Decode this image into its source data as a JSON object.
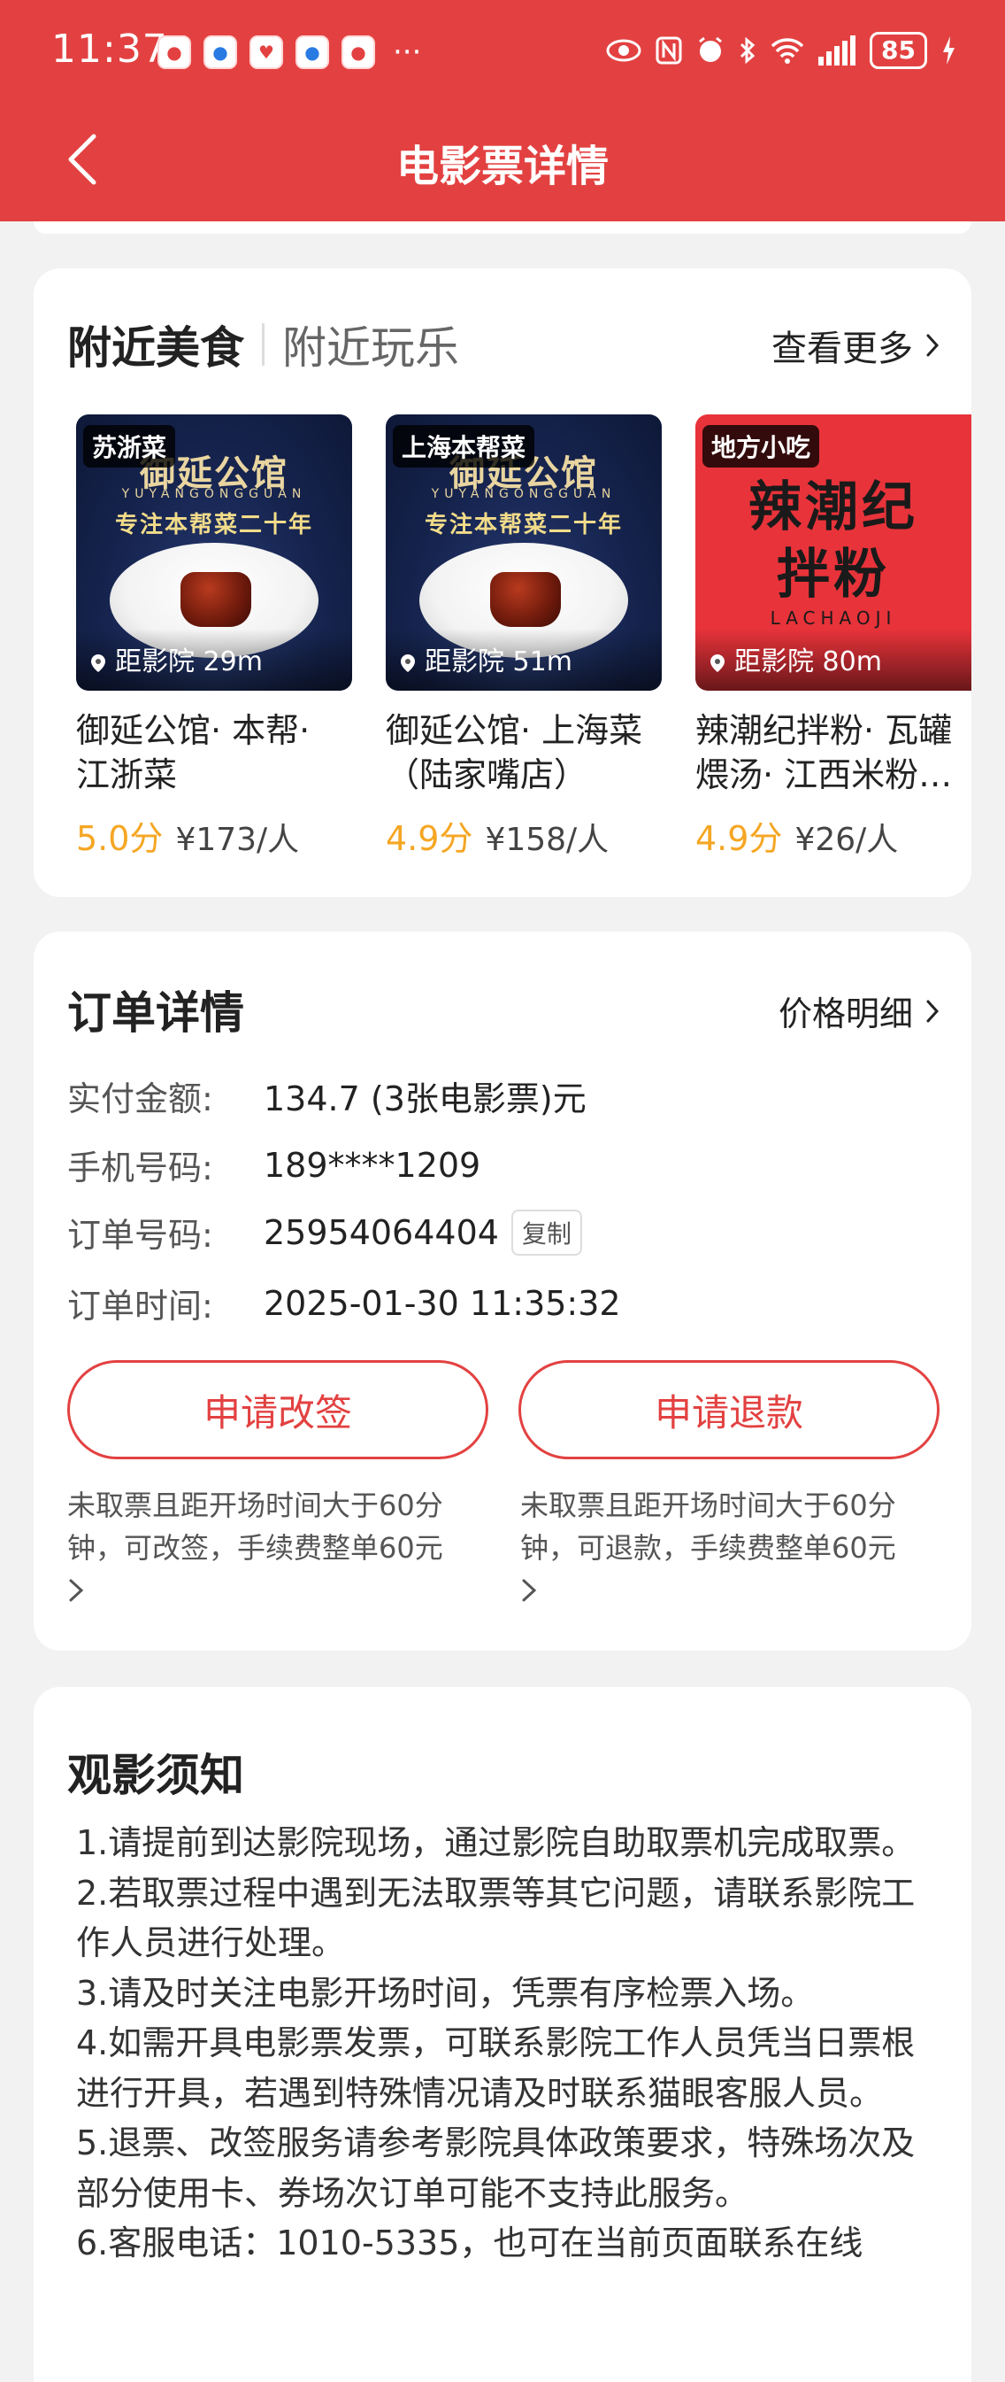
{
  "status_bar": {
    "time": "11:37",
    "more": "···",
    "battery": "85"
  },
  "header": {
    "title": "电影票详情"
  },
  "food_section": {
    "tab_active": "附近美食",
    "tab_inactive": "附近玩乐",
    "see_more": "查看更多",
    "items": [
      {
        "tag": "苏浙菜",
        "distance": "距影院 29m",
        "name": "御延公馆· 本帮· 江浙菜",
        "score": "5.0分",
        "price": "¥173/人",
        "img_brand": "御延公馆",
        "img_sub": "YUYANGONGGUAN",
        "img_slogan": "专注本帮菜二十年"
      },
      {
        "tag": "上海本帮菜",
        "distance": "距影院 51m",
        "name": "御延公馆· 上海菜（陆家嘴店）",
        "score": "4.9分",
        "price": "¥158/人",
        "img_brand": "御延公馆",
        "img_sub": "YUYANGONGGUAN",
        "img_slogan": "专注本帮菜二十年"
      },
      {
        "tag": "地方小吃",
        "distance": "距影院 80m",
        "name": "辣潮纪拌粉· 瓦罐煨汤· 江西米粉…",
        "score": "4.9分",
        "price": "¥26/人",
        "img_line1": "辣潮纪",
        "img_line2": "拌粉",
        "img_line3": "LACHAOJI"
      }
    ]
  },
  "order": {
    "title": "订单详情",
    "price_detail": "价格明细",
    "rows": [
      {
        "label": "实付金额:",
        "value": "134.7 (3张电影票)元"
      },
      {
        "label": "手机号码:",
        "value": "189****1209"
      },
      {
        "label": "订单号码:",
        "value": "25954064404"
      },
      {
        "label": "订单时间:",
        "value": "2025-01-30 11:35:32"
      }
    ],
    "copy_label": "复制",
    "change_button": "申请改签",
    "refund_button": "申请退款",
    "change_note": "未取票且距开场时间大于60分钟，可改签，手续费整单60元",
    "refund_note": "未取票且距开场时间大于60分钟，可退款，手续费整单60元"
  },
  "notice": {
    "title": "观影须知",
    "items": [
      "1.请提前到达影院现场，通过影院自助取票机完成取票。",
      "2.若取票过程中遇到无法取票等其它问题，请联系影院工作人员进行处理。",
      "3.请及时关注电影开场时间，凭票有序检票入场。",
      "4.如需开具电影票发票，可联系影院工作人员凭当日票根进行开具，若遇到特殊情况请及时联系猫眼客服人员。",
      "5.退票、改签服务请参考影院具体政策要求，特殊场次及部分使用卡、券场次订单可能不支持此服务。",
      "6.客服电话：1010-5335，也可在当前页面联系在线"
    ]
  },
  "colors": {
    "brand_red": "#e34141",
    "score_orange": "#f5a623"
  }
}
